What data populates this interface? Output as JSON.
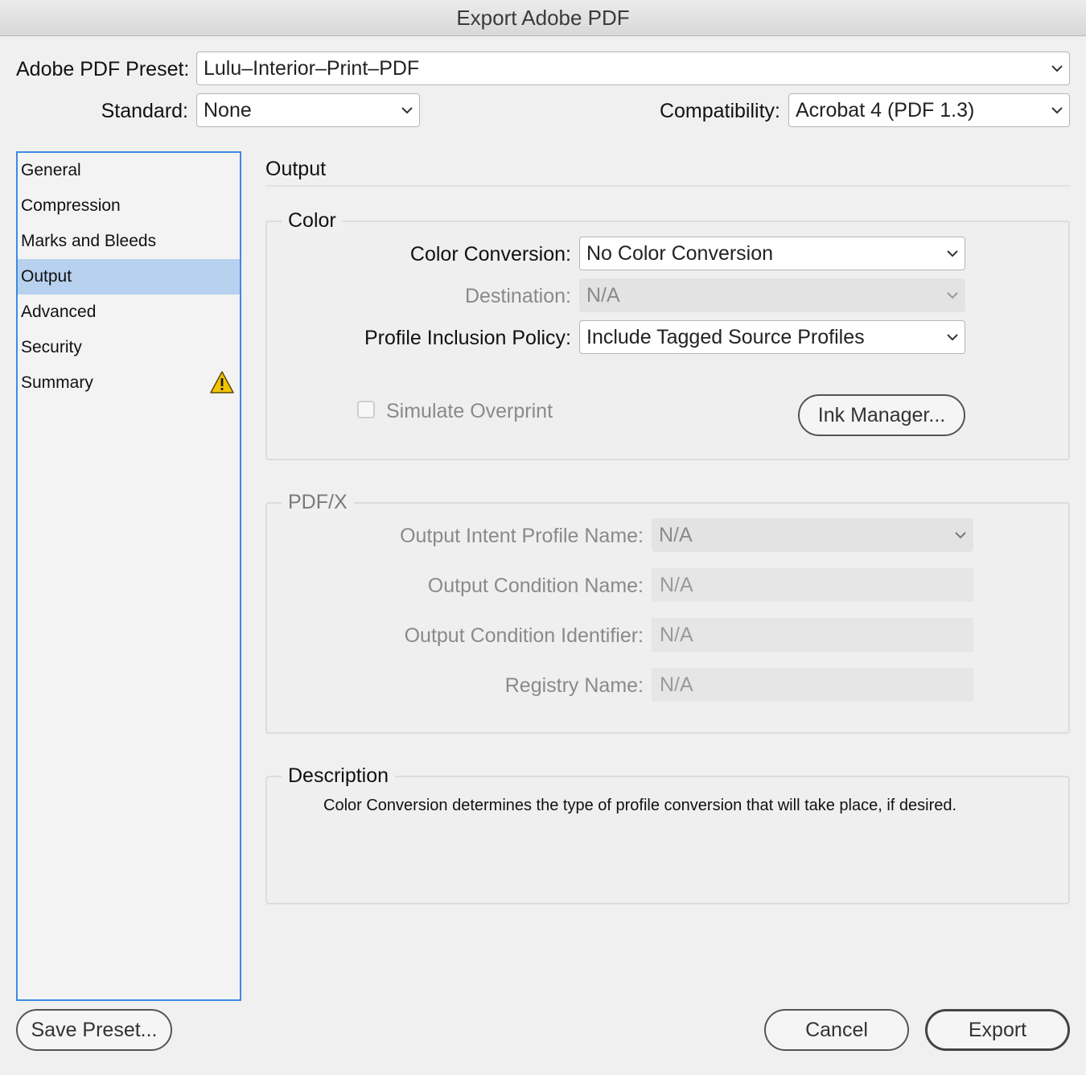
{
  "window": {
    "title": "Export Adobe PDF"
  },
  "top": {
    "preset_label": "Adobe PDF Preset:",
    "preset_value": "Lulu–Interior–Print–PDF",
    "standard_label": "Standard:",
    "standard_value": "None",
    "compat_label": "Compatibility:",
    "compat_value": "Acrobat 4 (PDF 1.3)"
  },
  "sidebar": {
    "items": [
      {
        "label": "General"
      },
      {
        "label": "Compression"
      },
      {
        "label": "Marks and Bleeds"
      },
      {
        "label": "Output"
      },
      {
        "label": "Advanced"
      },
      {
        "label": "Security"
      },
      {
        "label": "Summary"
      }
    ],
    "selected": "Output",
    "warning_icon": "warning-triangle-icon"
  },
  "panel": {
    "title": "Output",
    "color": {
      "legend": "Color",
      "conversion_label": "Color Conversion:",
      "conversion_value": "No Color Conversion",
      "destination_label": "Destination:",
      "destination_value": "N/A",
      "profile_label": "Profile Inclusion Policy:",
      "profile_value": "Include Tagged Source Profiles",
      "simulate_label": "Simulate Overprint",
      "ink_button": "Ink Manager..."
    },
    "pdfx": {
      "legend": "PDF/X",
      "intent_label": "Output Intent Profile Name:",
      "intent_value": "N/A",
      "cond_name_label": "Output Condition Name:",
      "cond_name_value": "N/A",
      "cond_id_label": "Output Condition Identifier:",
      "cond_id_value": "N/A",
      "registry_label": "Registry Name:",
      "registry_value": "N/A"
    },
    "description": {
      "legend": "Description",
      "text": "Color Conversion determines the type of profile conversion that will take place, if desired."
    }
  },
  "footer": {
    "save_preset": "Save Preset...",
    "cancel": "Cancel",
    "export": "Export"
  },
  "colors": {
    "selection": "#b7d1ef",
    "sidebar_border": "#3d8ae4",
    "warning": "#f2c500"
  }
}
